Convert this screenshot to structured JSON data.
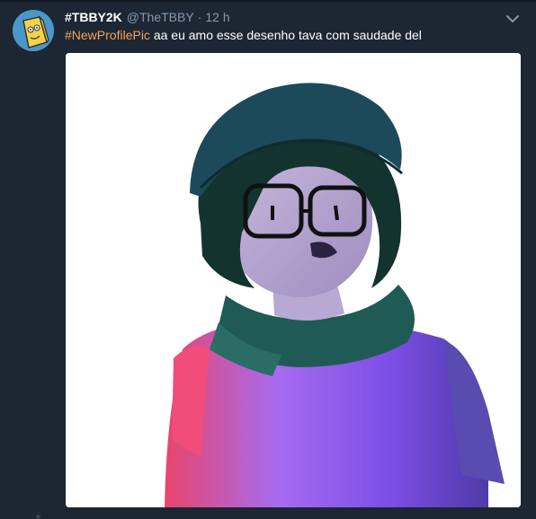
{
  "tweet": {
    "display_name": "#TBBY2K",
    "handle": "@TheTBBY",
    "separator": "·",
    "time": "12 h",
    "hashtag": "#NewProfilePic",
    "text": " aa eu amo esse desenho tava com saudade del"
  },
  "icons": {
    "caret": "chevron-down-icon",
    "avatar": "user-avatar"
  },
  "colors": {
    "background": "#1c2733",
    "hashtag": "#f5a25d",
    "secondary_text": "#8899a6"
  }
}
